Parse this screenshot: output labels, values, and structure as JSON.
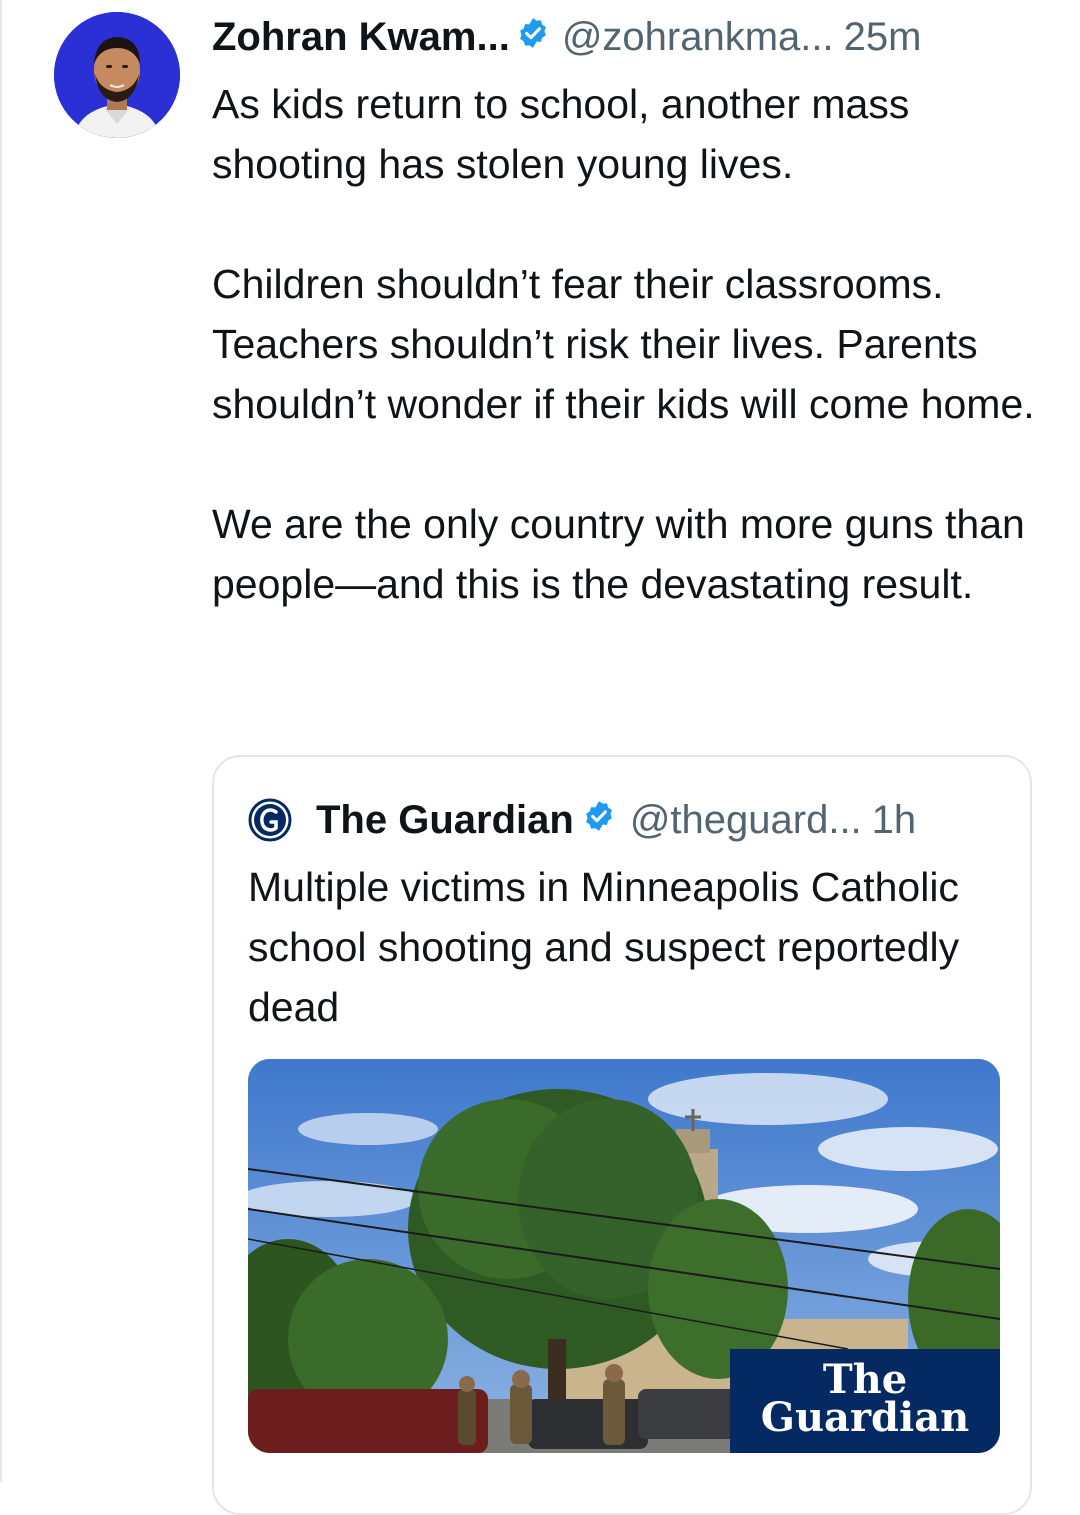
{
  "tweet": {
    "author_name": "Zohran Kwam...",
    "handle": "@zohrankma...",
    "time": "25m",
    "verified_icon": "verified-badge-icon",
    "paragraphs": [
      "As kids return to school, another mass shooting has stolen young lives.",
      "Children shouldn’t fear their classrooms. Teachers shouldn’t risk their lives. Parents shouldn’t wonder if their kids will come home.",
      "We are the only country with more guns than people—and this is the devastating result."
    ]
  },
  "quote": {
    "author_name": "The Guardian",
    "handle": "@theguard...",
    "time": "1h",
    "text": "Multiple victims in Minneapolis Catholic school shooting and suspect reportedly dead",
    "image_brand_line1": "The",
    "image_brand_line2": "Guardian"
  },
  "colors": {
    "verified_blue": "#1d9bf0",
    "secondary_text": "#536471",
    "guardian_navy": "#052962",
    "avatar_bg": "#2b2fd6"
  }
}
